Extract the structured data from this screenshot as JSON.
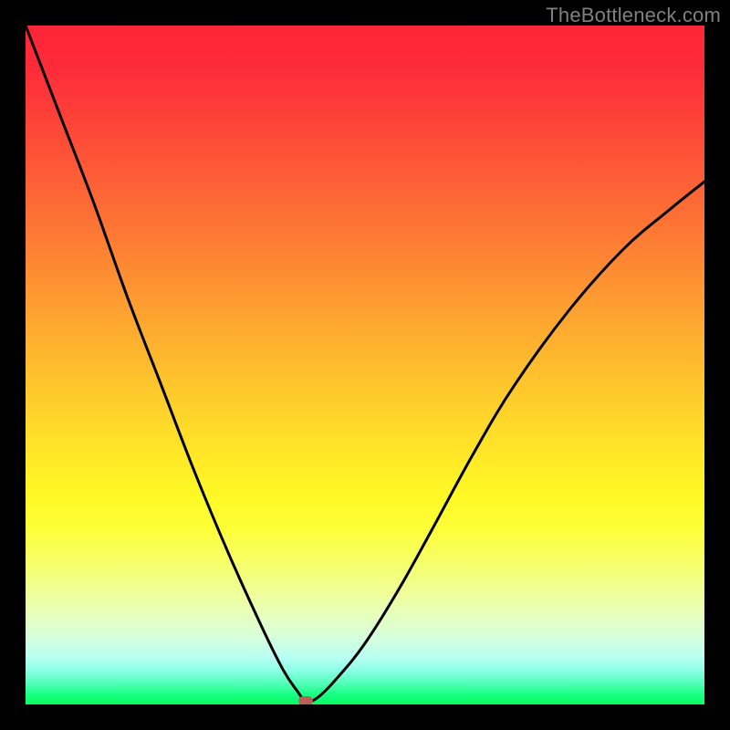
{
  "watermark": "TheBottleneck.com",
  "chart_data": {
    "type": "line",
    "title": "",
    "xlabel": "",
    "ylabel": "",
    "xlim": [
      0,
      100
    ],
    "ylim": [
      0,
      100
    ],
    "grid": false,
    "legend": false,
    "background_gradient": {
      "top": "#fd2539",
      "bottom": "#04ff5f",
      "description": "vertical red-to-green gradient"
    },
    "series": [
      {
        "name": "bottleneck-curve",
        "color": "#000000",
        "x": [
          0,
          5,
          10,
          15,
          20,
          25,
          30,
          35,
          38,
          40,
          41.3,
          43,
          46,
          50,
          55,
          60,
          66,
          72,
          80,
          88,
          95,
          100
        ],
        "y": [
          100,
          87,
          74,
          60,
          47,
          34,
          22,
          11,
          5,
          2,
          0.5,
          1,
          4,
          9,
          17,
          26,
          37,
          47,
          58,
          67,
          73,
          77
        ]
      }
    ],
    "marker": {
      "x": 41.3,
      "y": 0.5,
      "color": "#b96156",
      "shape": "rounded-rect"
    }
  }
}
